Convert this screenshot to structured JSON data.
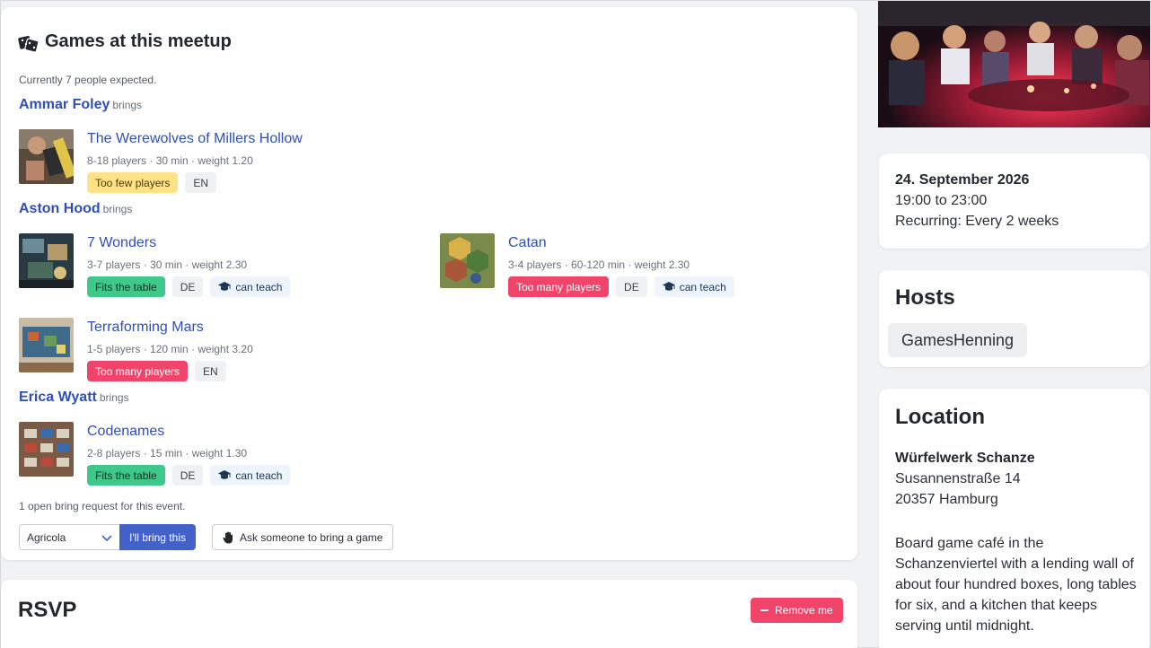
{
  "games_section": {
    "title": "Games at this meetup",
    "title_icon": "dice-icon",
    "expected_text": "Currently 7 people expected.",
    "brings_label": "brings",
    "people": [
      {
        "name": "Ammar Foley",
        "games": [
          {
            "title": "The Werewolves of Millers Hollow",
            "meta": "8-18 players · 30 min · weight 1.20",
            "tags": [
              {
                "text": "Too few players",
                "kind": "warn"
              },
              {
                "text": "EN",
                "kind": "lang"
              }
            ]
          }
        ]
      },
      {
        "name": "Aston Hood",
        "games": [
          {
            "title": "7 Wonders",
            "meta": "3-7 players · 30 min · weight 2.30",
            "tags": [
              {
                "text": "Fits the table",
                "kind": "ok"
              },
              {
                "text": "DE",
                "kind": "lang"
              },
              {
                "text": "can teach",
                "kind": "teach"
              }
            ]
          },
          {
            "title": "Catan",
            "meta": "3-4 players · 60-120 min · weight 2.30",
            "tags": [
              {
                "text": "Too many players",
                "kind": "bad"
              },
              {
                "text": "DE",
                "kind": "lang"
              },
              {
                "text": "can teach",
                "kind": "teach"
              }
            ]
          },
          {
            "title": "Terraforming Mars",
            "meta": "1-5 players · 120 min · weight 3.20",
            "tags": [
              {
                "text": "Too many players",
                "kind": "bad"
              },
              {
                "text": "EN",
                "kind": "lang"
              }
            ]
          }
        ]
      },
      {
        "name": "Erica Wyatt",
        "games": [
          {
            "title": "Codenames",
            "meta": "2-8 players · 15 min · weight 1.30",
            "tags": [
              {
                "text": "Fits the table",
                "kind": "ok"
              },
              {
                "text": "DE",
                "kind": "lang"
              },
              {
                "text": "can teach",
                "kind": "teach"
              }
            ]
          }
        ]
      }
    ],
    "open_request_text": "1 open bring request for this event.",
    "game_select_value": "Agricola",
    "bring_button": "I'll bring this",
    "ask_button": "Ask someone to bring a game"
  },
  "rsvp": {
    "title": "RSVP",
    "remove_button": "Remove me"
  },
  "event_info": {
    "date": "24. September 2026",
    "time": "19:00 to 23:00",
    "recurring": "Recurring: Every 2 weeks"
  },
  "hosts": {
    "title": "Hosts",
    "names": [
      "GamesHenning"
    ]
  },
  "location": {
    "title": "Location",
    "name": "Würfelwerk Schanze",
    "street": "Susannenstraße 14",
    "city": "20357 Hamburg",
    "description": "Board game café in the Schanzenviertel with a lending wall of about four hundred boxes, long tables for six, and a kitchen that keeps serving until midnight."
  },
  "colors": {
    "link": "#2f4fb6",
    "primary_button": "#4261c9",
    "danger": "#f1446a",
    "success": "#3fc88a",
    "warning": "#ffe187"
  }
}
